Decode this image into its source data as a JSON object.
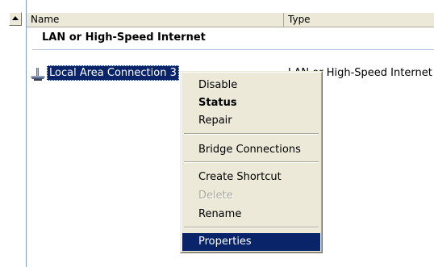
{
  "list_view": {
    "columns": {
      "name": "Name",
      "type": "Type"
    },
    "group_heading": "LAN or High-Speed Internet",
    "items": [
      {
        "label": "Local Area Connection 3",
        "type": "LAN or High-Speed Internet",
        "icon": "network-connection-icon",
        "selected": true
      }
    ]
  },
  "context_menu": {
    "items": [
      {
        "label": "Disable",
        "bold": false,
        "disabled": false
      },
      {
        "label": "Status",
        "bold": true,
        "disabled": false
      },
      {
        "label": "Repair",
        "bold": false,
        "disabled": false
      },
      {
        "label": "Bridge Connections",
        "bold": false,
        "disabled": false
      },
      {
        "label": "Create Shortcut",
        "bold": false,
        "disabled": false
      },
      {
        "label": "Delete",
        "bold": false,
        "disabled": true
      },
      {
        "label": "Rename",
        "bold": false,
        "disabled": false
      },
      {
        "label": "Properties",
        "bold": false,
        "disabled": false,
        "highlighted": true
      }
    ]
  },
  "colors": {
    "selection": "#0a246a",
    "menu_background": "#ece9d8",
    "disabled_text": "#aca899"
  }
}
